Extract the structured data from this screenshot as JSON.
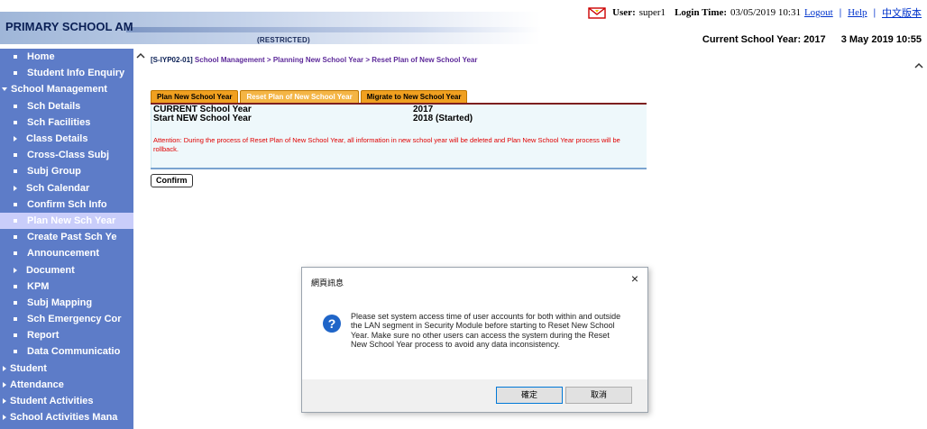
{
  "header": {
    "school_name": "PRIMARY SCHOOL AM",
    "restricted": "(RESTRICTED)",
    "user_label": "User:",
    "user_name": "super1",
    "login_label": "Login Time:",
    "login_time": "03/05/2019 10:31",
    "logout": "Logout",
    "separator": "|",
    "help": "Help",
    "chinese": "中文版本",
    "current_year_label": "Current School Year: 2017",
    "date_time": "3 May 2019 10:55"
  },
  "sidebar": {
    "items": [
      {
        "label": "Home",
        "kind": "bullet"
      },
      {
        "label": "Student Info Enquiry",
        "kind": "bullet"
      },
      {
        "label": "School Management",
        "kind": "open"
      },
      {
        "label": "Sch Details",
        "kind": "bullet"
      },
      {
        "label": "Sch Facilities",
        "kind": "bullet"
      },
      {
        "label": "Class Details",
        "kind": "arrow"
      },
      {
        "label": "Cross-Class Subj",
        "kind": "bullet"
      },
      {
        "label": "Subj Group",
        "kind": "bullet"
      },
      {
        "label": "Sch Calendar",
        "kind": "arrow"
      },
      {
        "label": "Confirm Sch Info",
        "kind": "bullet"
      },
      {
        "label": "Plan New Sch Year",
        "kind": "bullet",
        "active": true
      },
      {
        "label": "Create Past Sch Ye",
        "kind": "bullet"
      },
      {
        "label": "Announcement",
        "kind": "bullet"
      },
      {
        "label": "Document",
        "kind": "arrow"
      },
      {
        "label": "KPM",
        "kind": "bullet"
      },
      {
        "label": "Subj Mapping",
        "kind": "bullet"
      },
      {
        "label": "Sch Emergency Cor",
        "kind": "bullet"
      },
      {
        "label": "Report",
        "kind": "bullet"
      },
      {
        "label": "Data Communicatio",
        "kind": "bullet"
      },
      {
        "label": "Student",
        "kind": "top"
      },
      {
        "label": "Attendance",
        "kind": "top"
      },
      {
        "label": "Student Activities",
        "kind": "top"
      },
      {
        "label": "School Activities Mana",
        "kind": "top"
      }
    ]
  },
  "main": {
    "breadcrumb_code": "[S-IYP02-01]",
    "breadcrumb_path": "School Management > Planning New School Year > Reset Plan of New School Year",
    "tabs": [
      {
        "label": "Plan New School Year"
      },
      {
        "label": "Reset Plan of New School Year",
        "active": true
      },
      {
        "label": "Migrate to New School Year"
      }
    ],
    "rows": [
      {
        "label": "CURRENT School Year",
        "value": "2017"
      },
      {
        "label": "Start NEW School Year",
        "value": "2018 (Started)"
      }
    ],
    "attention": "Attention: During the process of Reset Plan of New School Year, all information in new school year will be deleted and Plan New School Year process will be rollback.",
    "confirm_label": "Confirm"
  },
  "dialog": {
    "title": "網頁訊息",
    "close": "×",
    "message": "Please set system access time of user accounts for both within and outside the LAN segment in Security Module before starting to Reset New School Year. Make sure no other users can access the system during the Reset New School Year process to avoid any data inconsistency.",
    "ok_label": "確定",
    "cancel_label": "取消",
    "icon": "question-icon"
  },
  "colors": {
    "sidebar_bg": "#5d7cc8",
    "active_item_bg": "#c9cdfa",
    "tab_bg": "#f0a020",
    "attention_text": "#e00000",
    "breadcrumb_text": "#5d2a9a"
  }
}
